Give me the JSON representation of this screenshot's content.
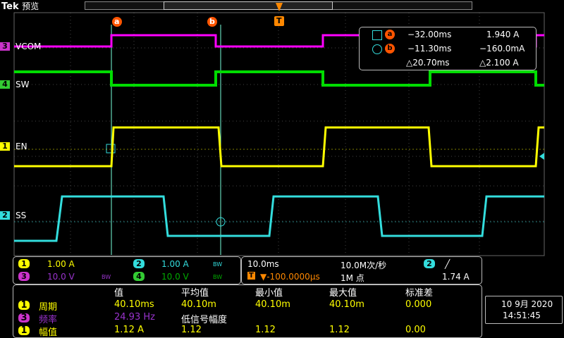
{
  "header": {
    "brand": "Tek",
    "mode": "预览"
  },
  "cursor_markers": {
    "a": "a",
    "b": "b",
    "trigger": "T"
  },
  "channels": {
    "ch3": {
      "num": "3",
      "name": "VCOM",
      "color": "#ff00ff"
    },
    "ch4": {
      "num": "4",
      "name": "SW",
      "color": "#00dd00"
    },
    "ch1": {
      "num": "1",
      "name": "EN",
      "color": "#ffff00"
    },
    "ch2": {
      "num": "2",
      "name": "SS",
      "color": "#33dddd"
    }
  },
  "cursor_readout": {
    "a_time": "−32.00ms",
    "a_value": "1.940 A",
    "b_time": "−11.30ms",
    "b_value": "−160.0mA",
    "delta_time": "△20.70ms",
    "delta_value": "△2.100 A"
  },
  "vertical": {
    "ch1": {
      "num": "1",
      "scale": "1.00 A"
    },
    "ch2": {
      "num": "2",
      "scale": "1.00 A"
    },
    "ch3": {
      "num": "3",
      "scale": "10.0 V"
    },
    "ch4": {
      "num": "4",
      "scale": "10.0 V"
    },
    "bw": "BW"
  },
  "horizontal": {
    "timebase": "10.0ms",
    "sample_rate": "10.0M次/秒",
    "position": "▼-100.0000μs",
    "record_length": "1M 点",
    "trigger_channel": "2",
    "trigger_slope": "╱",
    "trigger_level": "1.74 A"
  },
  "measurements": {
    "headers": [
      "值",
      "平均值",
      "最小值",
      "最大值",
      "标准差"
    ],
    "rows": [
      {
        "ch": "1",
        "name": "周期",
        "value": "40.10ms",
        "mean": "40.10m",
        "min": "40.10m",
        "max": "40.10m",
        "std": "0.000"
      },
      {
        "ch": "3",
        "name": "频率",
        "value": "24.93 Hz",
        "note": "低信号幅度"
      },
      {
        "ch": "1",
        "name": "幅值",
        "value": "1.12 A",
        "mean": "1.12",
        "min": "1.12",
        "max": "1.12",
        "std": "0.00"
      }
    ]
  },
  "datetime": {
    "date": "10 9月 2020",
    "time": "14:51:45"
  }
}
